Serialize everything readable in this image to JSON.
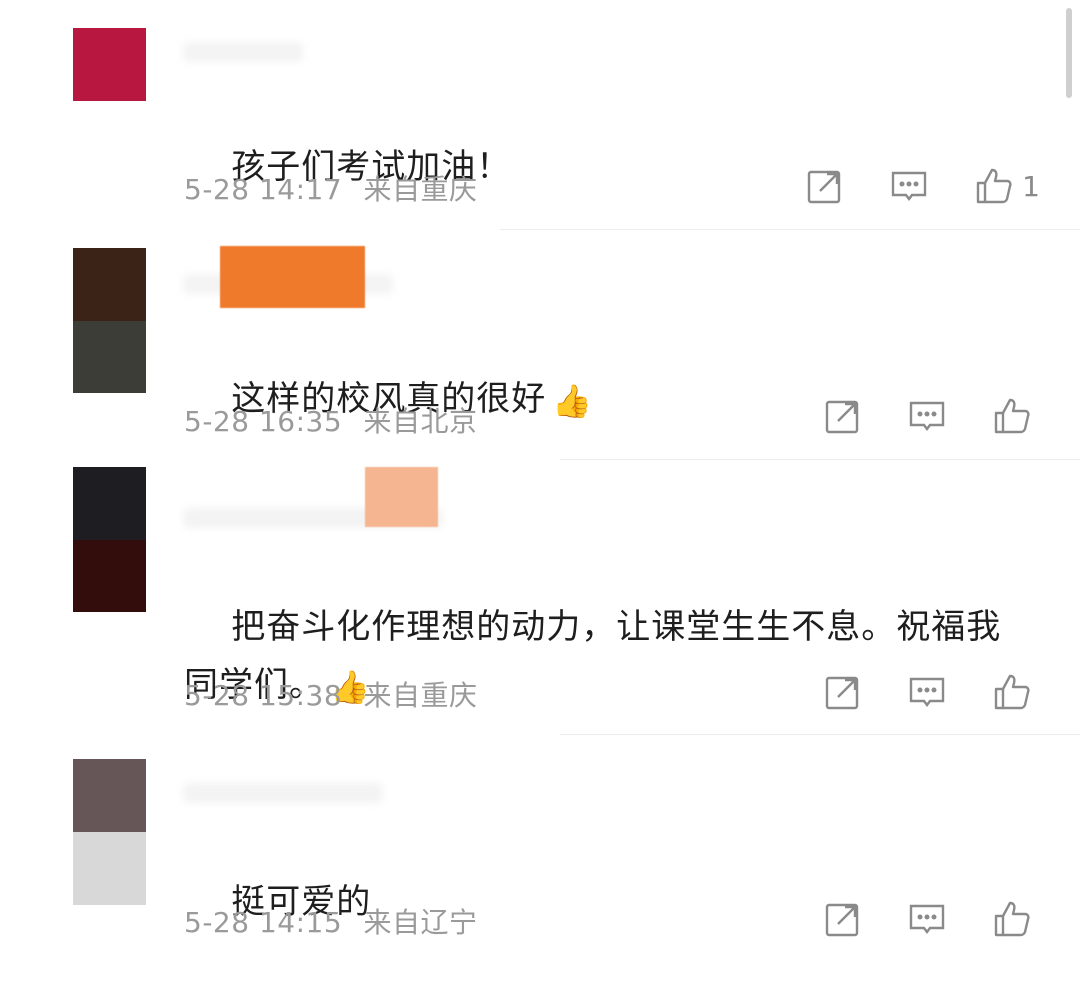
{
  "comments": [
    {
      "text": "孩子们考试加油！",
      "time": "5-28 14:17",
      "location": "来自重庆",
      "like_count": "1",
      "has_emoji": false
    },
    {
      "text": "这样的校风真的很好",
      "time": "5-28 16:35",
      "location": "来自北京",
      "like_count": "",
      "has_emoji": true,
      "emoji": "👍"
    },
    {
      "text": "把奋斗化作理想的动力，让课堂生生不息。祝福我同学们。",
      "time": "5-28 15:38",
      "location": "来自重庆",
      "like_count": "",
      "has_emoji": true,
      "emoji": "👍"
    },
    {
      "text": "挺可爱的",
      "time": "5-28 14:15",
      "location": "来自辽宁",
      "like_count": "",
      "has_emoji": false
    }
  ],
  "icons": {
    "share": "share-icon",
    "reply": "comment-icon",
    "like": "thumbs-up-icon"
  },
  "colors": {
    "text": "#1e1e1e",
    "meta": "#9a9a9a",
    "icon": "#8a8a8a",
    "avatar1": [
      "#b8173f",
      "#c01f48"
    ],
    "avatar2": [
      "#3c2317",
      "#3d3d38"
    ],
    "avatar3": [
      "#1e1e22",
      "#330c0c"
    ],
    "avatar4": [
      "#665658",
      "#d8d8d8"
    ],
    "badge2": "#f07a2c",
    "badge3": "#f5b590"
  }
}
